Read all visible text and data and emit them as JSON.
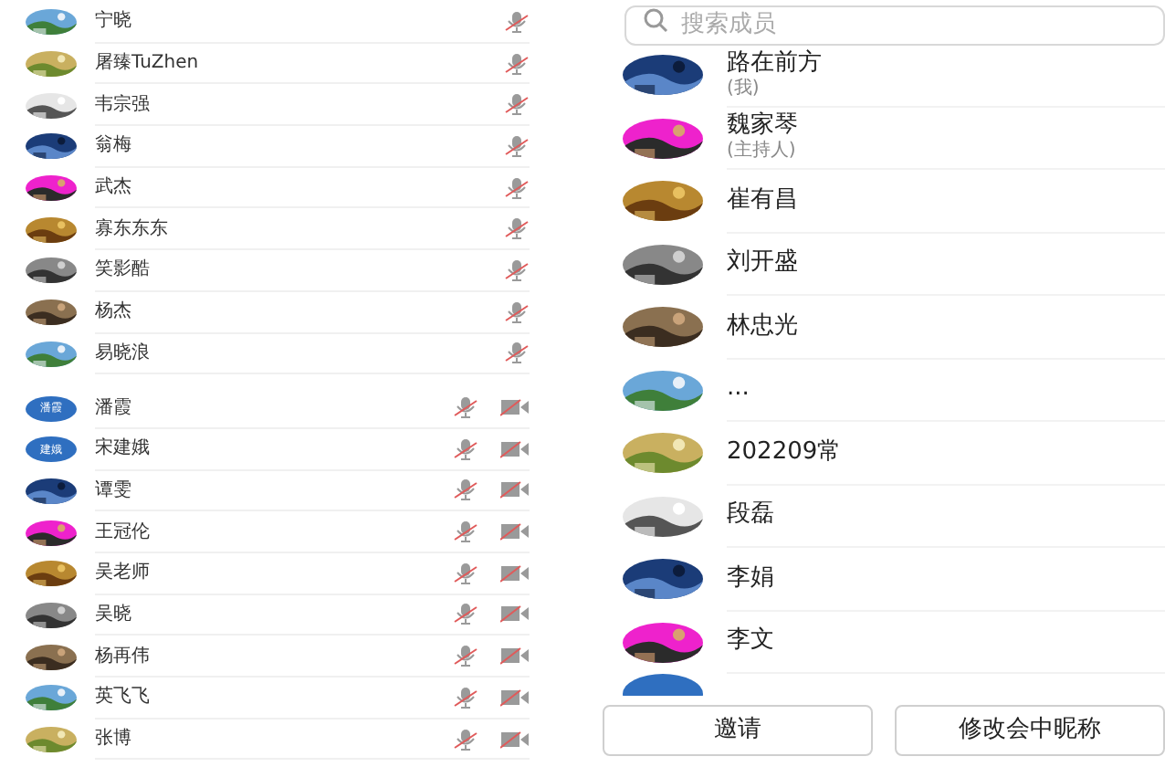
{
  "attendee_list": {
    "members": [
      {
        "name": "宁晓",
        "mic_off": true,
        "camera_off": false
      },
      {
        "name": "屠臻TuZhen",
        "mic_off": true,
        "camera_off": false
      },
      {
        "name": "韦宗强",
        "mic_off": true,
        "camera_off": false
      },
      {
        "name": "翁梅",
        "mic_off": true,
        "camera_off": false
      },
      {
        "name": "武杰",
        "mic_off": true,
        "camera_off": false
      },
      {
        "name": "寡东东东",
        "mic_off": true,
        "camera_off": false
      },
      {
        "name": "笑影酷",
        "mic_off": true,
        "camera_off": false
      },
      {
        "name": "杨杰",
        "mic_off": true,
        "camera_off": false
      },
      {
        "name": "易晓浪",
        "mic_off": true,
        "camera_off": false
      },
      {
        "name": "潘霞",
        "avatar_text": "潘霞",
        "mic_off": true,
        "camera_off": true
      },
      {
        "name": "宋建娥",
        "avatar_text": "建娥",
        "mic_off": true,
        "camera_off": true
      },
      {
        "name": "谭雯",
        "mic_off": true,
        "camera_off": true
      },
      {
        "name": "王冠伦",
        "mic_off": true,
        "camera_off": true
      },
      {
        "name": "吴老师",
        "mic_off": true,
        "camera_off": true
      },
      {
        "name": "吴晓",
        "mic_off": true,
        "camera_off": true
      },
      {
        "name": "杨再伟",
        "mic_off": true,
        "camera_off": true
      },
      {
        "name": "英飞飞",
        "mic_off": true,
        "camera_off": true
      },
      {
        "name": "张博",
        "mic_off": true,
        "camera_off": true
      }
    ]
  },
  "member_panel": {
    "search": {
      "placeholder": "搜索成员"
    },
    "members": [
      {
        "name": "路在前方",
        "role": "(我)"
      },
      {
        "name": "魏家琴",
        "role": "(主持人)"
      },
      {
        "name": "崔有昌"
      },
      {
        "name": "刘开盛"
      },
      {
        "name": "林忠光"
      },
      {
        "name": "..."
      },
      {
        "name": "202209常"
      },
      {
        "name": "段磊"
      },
      {
        "name": "李娟"
      },
      {
        "name": "李文"
      }
    ],
    "buttons": [
      "邀请",
      "修改会中昵称"
    ]
  }
}
